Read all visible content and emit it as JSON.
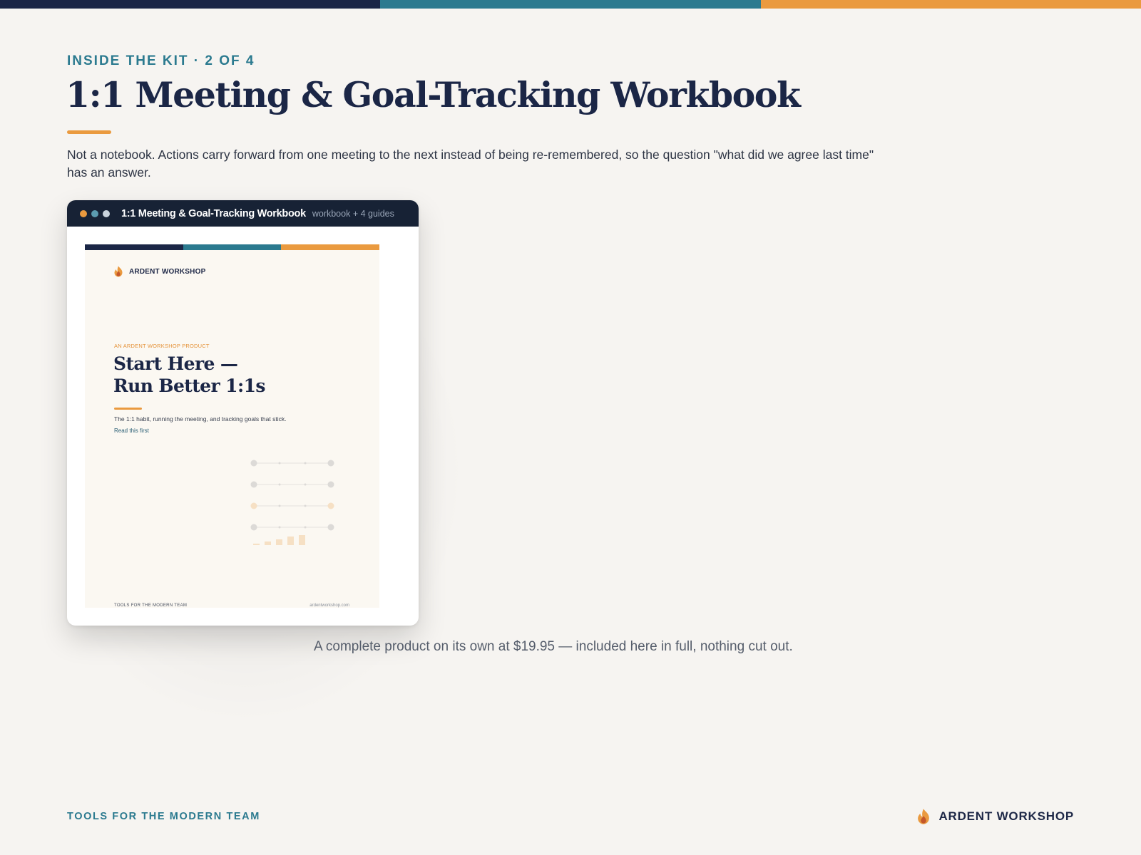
{
  "colors": {
    "navy": "#1b2646",
    "teal": "#2b7a8f",
    "orange": "#ea9a3f",
    "background": "#f6f4f1"
  },
  "header": {
    "eyebrow": "INSIDE THE KIT · 2 OF 4",
    "title": "1:1 Meeting & Goal-Tracking Workbook",
    "description": "Not a notebook. Actions carry forward from one meeting to the next instead of being re-remembered, so the question \"what did we agree last time\" has an answer."
  },
  "preview_card": {
    "window_title": "1:1 Meeting & Goal-Tracking Workbook",
    "window_subtitle": "workbook + 4 guides",
    "window_dots": [
      "#ea9a3f",
      "#5b9bb0",
      "#c9d3dc"
    ],
    "page": {
      "brand": "ARDENT WORKSHOP",
      "brand_icon": "flame-logo-icon",
      "product_tag": "AN ARDENT WORKSHOP PRODUCT",
      "title_line1": "Start Here —",
      "title_line2": "Run Better 1:1s",
      "description": "The 1:1 habit, running the meeting, and tracking goals that stick.",
      "read_note": "Read this first",
      "footer_left": "TOOLS FOR THE MODERN TEAM",
      "footer_right": "ardentworkshop.com"
    }
  },
  "caption": "A complete product on its own at $19.95 — included here in full, nothing cut out.",
  "footer": {
    "tagline": "TOOLS FOR THE MODERN TEAM",
    "brand": "ARDENT WORKSHOP",
    "brand_icon": "flame-logo-icon"
  }
}
